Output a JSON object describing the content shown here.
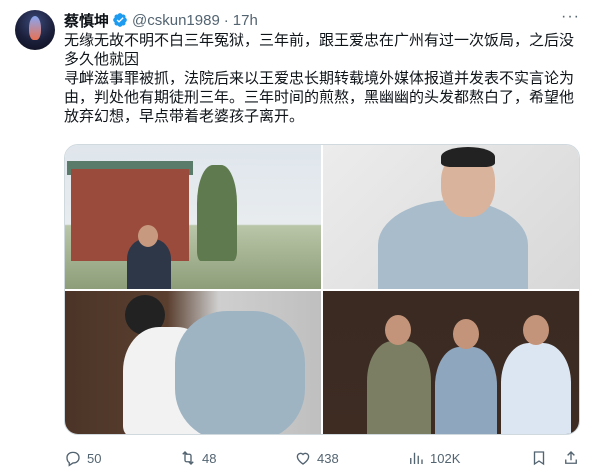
{
  "tweet": {
    "author_name": "蔡慎坤",
    "handle": "@cskun1989",
    "separator": "·",
    "time": "17h",
    "more": "···",
    "text": "无缘无故不明不白三年冤狱，三年前，跟王爱忠在广州有过一次饭局，之后没多久他就因\n寻衅滋事罪被抓，法院后来以王爱忠长期转载境外媒体报道并发表不实言论为由，判处他有期徒刑三年。三年时间的煎熬，黑幽幽的头发都熬白了，希望他放弃幻想，早点带着老婆孩子离开。"
  },
  "actions": {
    "reply_count": "50",
    "retweet_count": "48",
    "like_count": "438",
    "views_count": "102K"
  },
  "colors": {
    "verified": "#1d9bf0",
    "muted": "#536471",
    "text": "#0f1419"
  }
}
